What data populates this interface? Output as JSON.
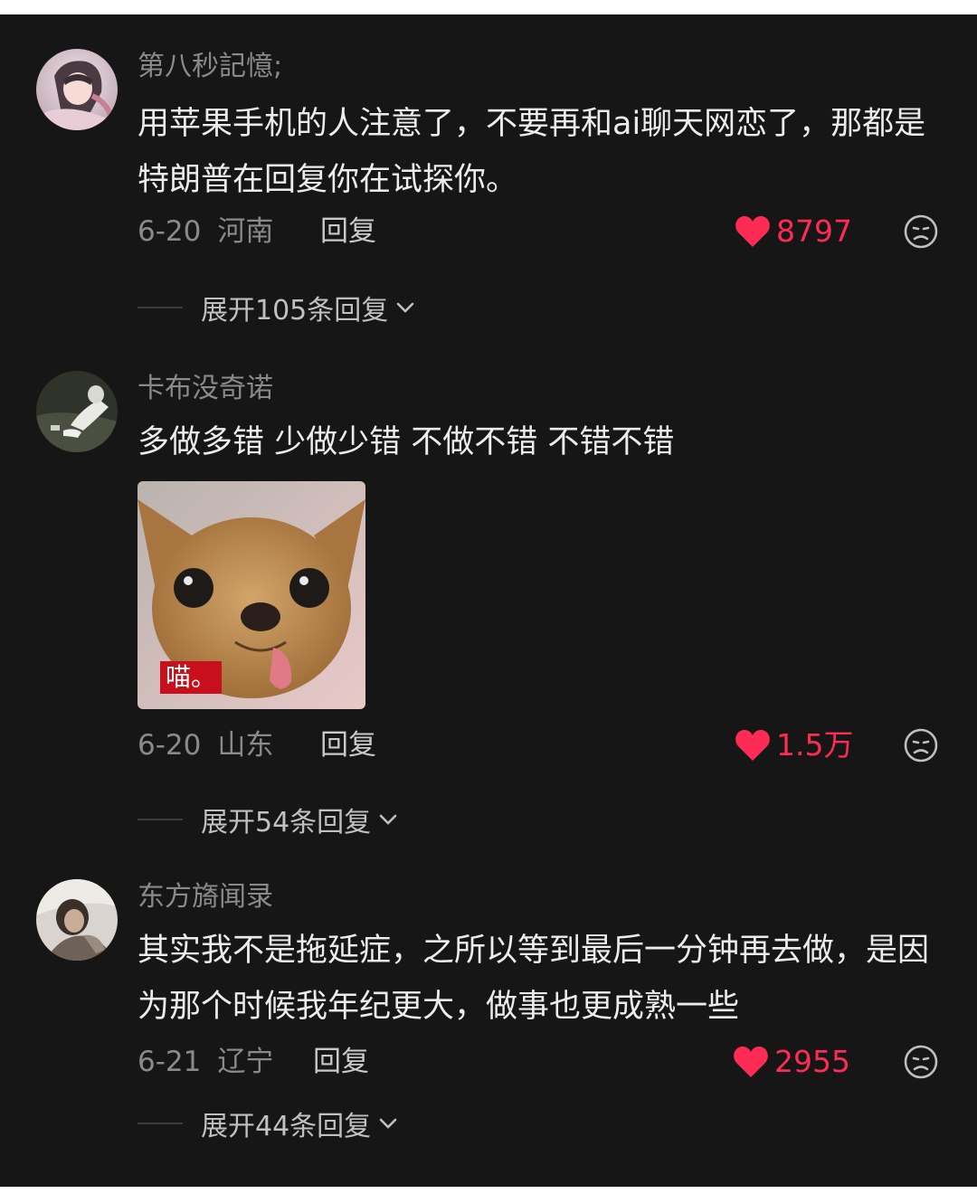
{
  "colors": {
    "background": "#161616",
    "text": "#ececec",
    "secondary_text": "#8a8a8a",
    "like_accent": "#fe2c55"
  },
  "comments": [
    {
      "username": "第八秒記憶;",
      "text": "用苹果手机的人注意了，不要再和ai聊天网恋了，那都是特朗普在回复你在试探你。",
      "date": "6-20",
      "region": "河南",
      "reply_label": "回复",
      "like_icon": "heart-icon",
      "likes": "8797",
      "expand_label": "展开105条回复"
    },
    {
      "username": "卡布没奇诺",
      "text": "多做多错 少做少错 不做不错 不错不错",
      "sticker_caption": "喵。",
      "date": "6-20",
      "region": "山东",
      "reply_label": "回复",
      "like_icon": "heart-icon",
      "likes": "1.5万",
      "expand_label": "展开54条回复"
    },
    {
      "username": "东方旖闻录",
      "text": "其实我不是拖延症，之所以等到最后一分钟再去做，是因为那个时候我年纪更大，做事也更成熟一些",
      "date": "6-21",
      "region": "辽宁",
      "reply_label": "回复",
      "like_icon": "heart-icon",
      "likes": "2955",
      "expand_label": "展开44条回复"
    }
  ]
}
